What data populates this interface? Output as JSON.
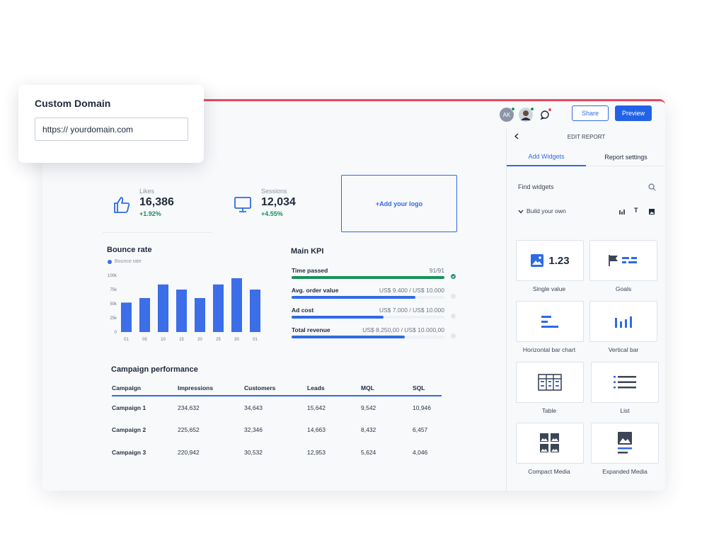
{
  "domain_card": {
    "title": "Custom Domain",
    "input_value": "https:// yourdomain.com"
  },
  "topbar": {
    "avatar_initials": "AK",
    "share_label": "Share",
    "preview_label": "Preview",
    "accent_color": "#e8485c"
  },
  "stats": [
    {
      "label": "Likes",
      "value": "16,386",
      "change": "+1.92%",
      "icon": "thumbs-up-icon"
    },
    {
      "label": "Sessions",
      "value": "12,034",
      "change": "+4.55%",
      "icon": "monitor-icon"
    }
  ],
  "logo_placeholder": "+Add your logo",
  "bounce": {
    "title": "Bounce rate",
    "legend": "Bounce rate"
  },
  "chart_data": {
    "type": "bar",
    "title": "Bounce rate",
    "series": [
      {
        "name": "Bounce rate",
        "values": [
          52,
          60,
          84,
          75,
          60,
          84,
          95,
          75
        ]
      }
    ],
    "categories": [
      "01",
      "05",
      "10",
      "15",
      "20",
      "25",
      "30",
      "01"
    ],
    "ylim": [
      0,
      100
    ],
    "yticks": [
      "0",
      "25k",
      "50k",
      "75k",
      "100k"
    ],
    "color": "#3b6ee8"
  },
  "kpi": {
    "title": "Main KPI",
    "items": [
      {
        "name": "Time passed",
        "amount": "91/91",
        "progress": 1.0,
        "color": "#17915a",
        "done": true
      },
      {
        "name": "Avg. order value",
        "amount": "US$ 9.400 / US$ 10.000",
        "progress": 0.81,
        "color": "#2f6ae6",
        "done": false
      },
      {
        "name": "Ad cost",
        "amount": "US$ 7.000 / US$ 10.000",
        "progress": 0.6,
        "color": "#2f6ae6",
        "done": false
      },
      {
        "name": "Total revenue",
        "amount": "US$ 8.250,00 / US$ 10.000,00",
        "progress": 0.74,
        "color": "#2f6ae6",
        "done": false
      }
    ]
  },
  "campaign": {
    "title": "Campaign performance",
    "headers": [
      "Campaign",
      "Impressions",
      "Customers",
      "Leads",
      "MQL",
      "SQL"
    ],
    "rows": [
      [
        "Campaign 1",
        "234,632",
        "34,643",
        "15,642",
        "9,542",
        "10,946"
      ],
      [
        "Campaign 2",
        "225,652",
        "32,346",
        "14,663",
        "8,432",
        "6,457"
      ],
      [
        "Campaign 3",
        "220,942",
        "30,532",
        "12,953",
        "5,624",
        "4,046"
      ]
    ]
  },
  "panel": {
    "title": "EDIT REPORT",
    "tabs": [
      "Add Widgets",
      "Report settings"
    ],
    "find_label": "Find widgets",
    "build_label": "Build your own",
    "single_value_text": "1.23",
    "widgets": [
      "Single value",
      "Goals",
      "Horizontal bar chart",
      "Vertical bar",
      "Table",
      "List",
      "Compact Media",
      "Expanded Media"
    ]
  }
}
